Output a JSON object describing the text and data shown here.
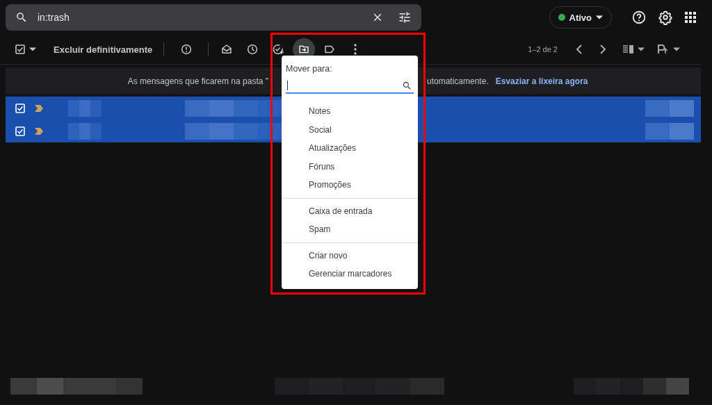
{
  "search": {
    "value": "in:trash"
  },
  "status": {
    "label": "Ativo"
  },
  "toolbar": {
    "action": "Excluir definitivamente",
    "move_active": true,
    "pagination": "1–2 de 2"
  },
  "banner": {
    "text_before": "As mensagens que ficarem na pasta \"",
    "text_after": "utomaticamente.",
    "link": "Esvaziar a lixeira agora"
  },
  "messages": [
    {
      "checked": true,
      "selected": true
    },
    {
      "checked": true,
      "selected": true
    }
  ],
  "move_menu": {
    "title": "Mover para:",
    "groups": [
      {
        "items": [
          "Notes",
          "Social",
          "Atualizações",
          "Fóruns",
          "Promoções"
        ]
      },
      {
        "items": [
          "Caixa de entrada",
          "Spam"
        ]
      },
      {
        "items": [
          "Criar novo",
          "Gerenciar marcadores"
        ]
      }
    ]
  }
}
